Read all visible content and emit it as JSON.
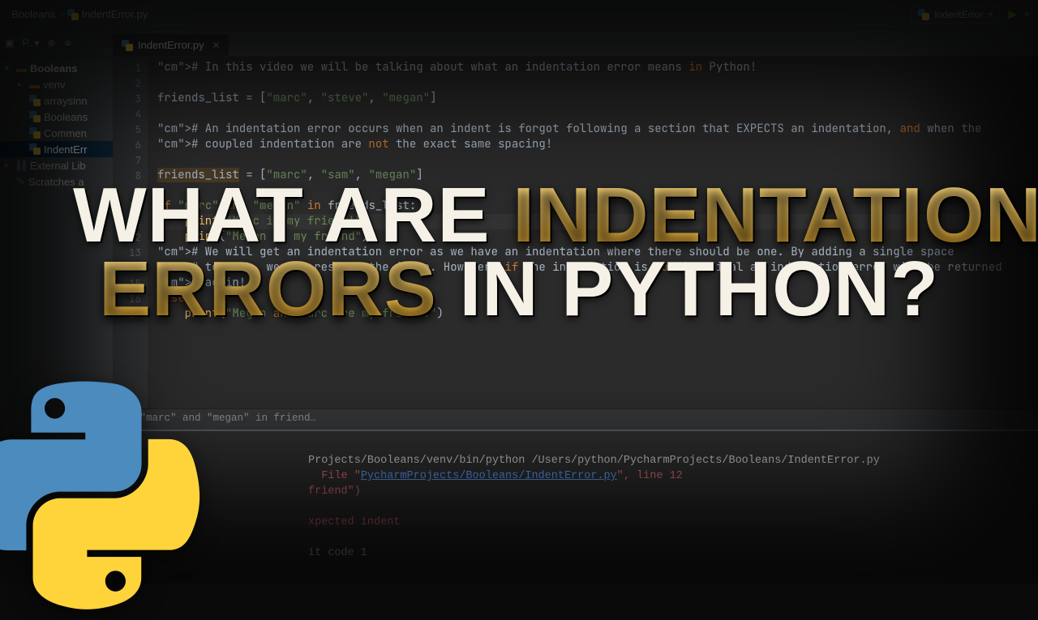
{
  "breadcrumb": {
    "project": "Booleans",
    "file": "IndentError.py"
  },
  "run_config": {
    "label": "IndentError"
  },
  "sidebar": {
    "toolbar_label": "P..",
    "items": [
      {
        "label": "Booleans",
        "kind": "project",
        "chev": "▾"
      },
      {
        "label": "venv",
        "kind": "venv",
        "chev": "▸"
      },
      {
        "label": "arraysinn",
        "kind": "py"
      },
      {
        "label": "Booleans",
        "kind": "py"
      },
      {
        "label": "Commen",
        "kind": "py"
      },
      {
        "label": "IndentErr",
        "kind": "py",
        "selected": true
      },
      {
        "label": "External Lib",
        "kind": "lib",
        "chev": "▸"
      },
      {
        "label": "Scratches a",
        "kind": "scratch"
      }
    ]
  },
  "tab": {
    "filename": "IndentError.py"
  },
  "code_lines": [
    "# In this video we will be talking about what an indentation error means in Python!",
    "",
    "friends_list = [\"marc\", \"steve\", \"megan\"]",
    "",
    "# An indentation error occurs when an indent is forgot following a section that EXPECTS an indentation, and when the",
    "# coupled indentation are not the exact same spacing!",
    "",
    "friends_list = [\"marc\", \"sam\", \"megan\"]",
    "",
    "if \"marc\" and \"megan\" in friends_list:",
    "    print(\"Marc is my friend!\")",
    "    print(\"Megan is my friend\")",
    "# We will get an indentation error as we have an indentation where there should be one. By adding a single space",
    "# to both, we can resolve the issue. However, if the indentation is not identical an indentation error will be returned",
    "# again!",
    "else:",
    "    print(\"Megan and Marc are my friend!\")"
  ],
  "line_count": 17,
  "current_line": 11,
  "editor_breadcrumb": "if \"marc\" and \"megan\" in friend…",
  "console": {
    "cmd": "Projects/Booleans/venv/bin/python /Users/python/PycharmProjects/Booleans/IndentError.py",
    "file_link": "PycharmProjects/Booleans/IndentError.py",
    "file_line": ", line 12",
    "snippet": "friend\")",
    "err": "xpected indent",
    "exit": "it code 1"
  },
  "overlay": {
    "w1": "WHAT ARE ",
    "w2": "INDENTATION",
    "w3": "ERRORS",
    "w4": " IN PYTHON?"
  }
}
